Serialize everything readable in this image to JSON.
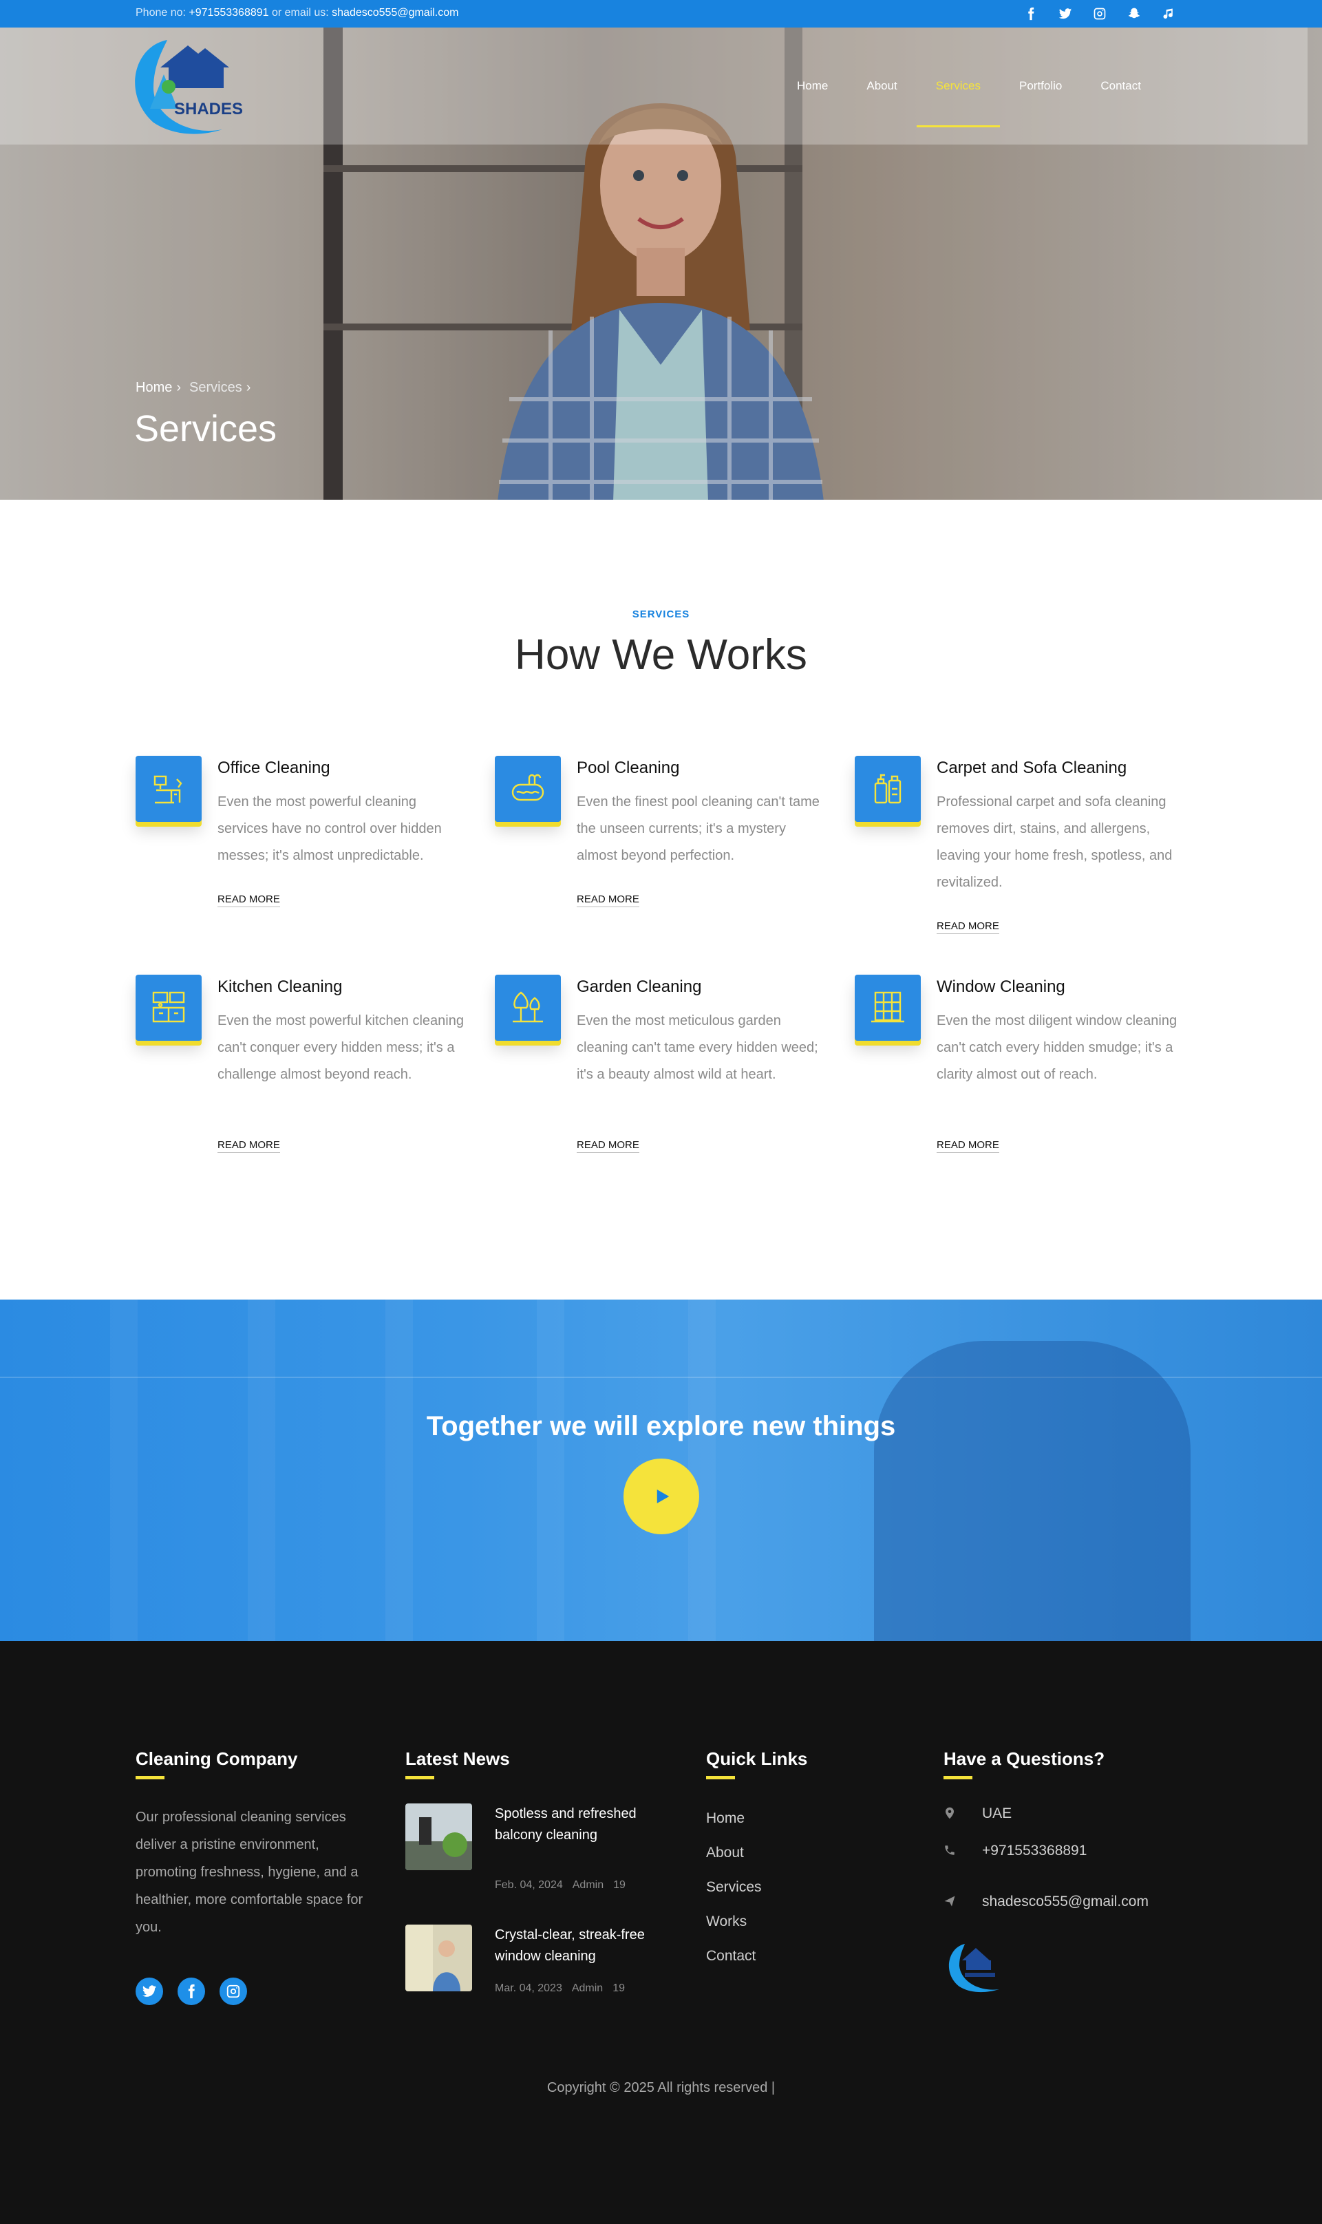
{
  "topbar": {
    "phone_label": "Phone no:",
    "phone": "+971553368891",
    "email_label": "or email us:",
    "email": "shadesco555@gmail.com",
    "socials": [
      "facebook-icon",
      "twitter-icon",
      "instagram-icon",
      "snapchat-icon",
      "tiktok-icon"
    ]
  },
  "brand": {
    "logo_text": "SHADES"
  },
  "nav": {
    "items": [
      {
        "label": "Home"
      },
      {
        "label": "About"
      },
      {
        "label": "Services"
      },
      {
        "label": "Portfolio"
      },
      {
        "label": "Contact"
      }
    ],
    "active": "Services"
  },
  "hero": {
    "breadcrumb": [
      "Home",
      "Services"
    ],
    "title": "Services"
  },
  "services_section": {
    "tag": "SERVICES",
    "title": "How We Works",
    "read_more": "READ MORE",
    "items": [
      {
        "title": "Office Cleaning",
        "text": "Even the most powerful cleaning services have no control over hidden messes; it's almost unpredictable.",
        "icon": "office-desk-icon"
      },
      {
        "title": "Pool Cleaning",
        "text": "Even the finest pool cleaning can't tame the unseen currents; it's a mystery almost beyond perfection.",
        "icon": "pool-icon"
      },
      {
        "title": "Carpet and Sofa Cleaning",
        "text": "Professional carpet and sofa cleaning removes dirt, stains, and allergens, leaving your home fresh, spotless, and revitalized.",
        "icon": "cleaning-bottle-icon"
      },
      {
        "title": "Kitchen Cleaning",
        "text": "Even the most powerful kitchen cleaning can't conquer every hidden mess; it's a challenge almost beyond reach.",
        "icon": "kitchen-icon"
      },
      {
        "title": "Garden Cleaning",
        "text": "Even the most meticulous garden cleaning can't tame every hidden weed; it's a beauty almost wild at heart.",
        "icon": "trees-icon"
      },
      {
        "title": "Window Cleaning",
        "text": "Even the most diligent window cleaning can't catch every hidden smudge; it's a clarity almost out of reach.",
        "icon": "window-icon"
      }
    ]
  },
  "band": {
    "title": "Together we will explore new things"
  },
  "footer": {
    "about": {
      "heading": "Cleaning Company",
      "text": "Our professional cleaning services deliver a pristine environment, promoting freshness, hygiene, and a healthier, more comfortable space for you.",
      "socials": [
        "twitter-icon",
        "facebook-icon",
        "instagram-icon"
      ]
    },
    "news": {
      "heading": "Latest News",
      "items": [
        {
          "title": "Spotless and refreshed balcony cleaning",
          "date": "Feb. 04, 2024",
          "author": "Admin",
          "count": "19"
        },
        {
          "title": "Crystal-clear, streak-free window cleaning",
          "date": "Mar. 04, 2023",
          "author": "Admin",
          "count": "19"
        }
      ]
    },
    "links": {
      "heading": "Quick Links",
      "items": [
        "Home",
        "About",
        "Services",
        "Works",
        "Contact"
      ]
    },
    "contact": {
      "heading": "Have a Questions?",
      "address": "UAE",
      "phone": "+971553368891",
      "email": "shadesco555@gmail.com"
    },
    "copyright": "Copyright © 2025 All rights reserved |"
  },
  "colors": {
    "primary": "#1883df",
    "accent": "#f5e33b",
    "footer_bg": "#121212"
  }
}
